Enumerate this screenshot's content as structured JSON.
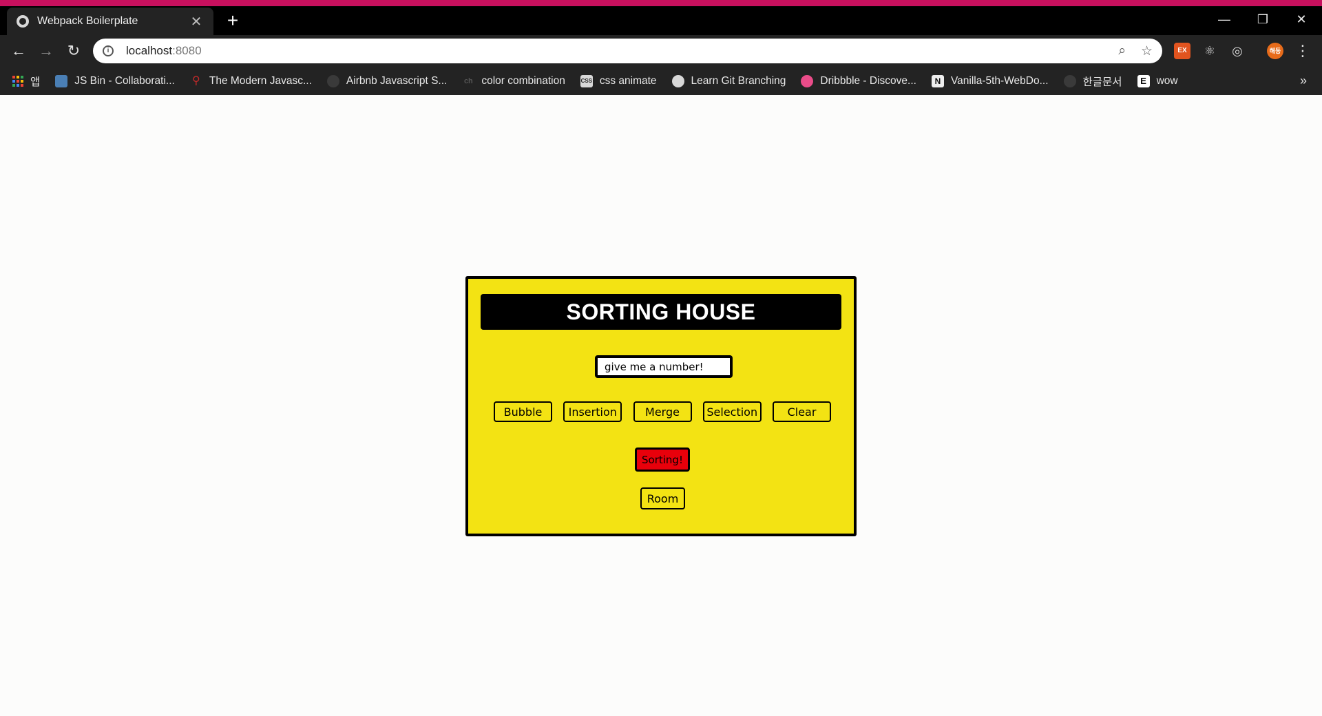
{
  "browser": {
    "tab": {
      "title": "Webpack Boilerplate",
      "close_glyph": "✕",
      "favicon": "globe-icon"
    },
    "new_tab_glyph": "+",
    "window_controls": {
      "minimize": "—",
      "restore": "❐",
      "close": "✕"
    },
    "nav": {
      "back": "←",
      "forward": "→",
      "reload": "↻"
    },
    "address": {
      "host": "localhost",
      "port": ":8080",
      "info_glyph": "i"
    },
    "omnibox_icons": {
      "zoom": "⌕",
      "star": "☆"
    },
    "extensions": [
      {
        "label": "EX",
        "color": "#e2541f"
      },
      {
        "label": "⚛",
        "color": "#232323"
      },
      {
        "label": "◎",
        "color": "#232323"
      }
    ],
    "profile": {
      "label": "해동",
      "color": "#e76b1a"
    },
    "menu_glyph": "⋮",
    "bookmarks": [
      {
        "label": "앱",
        "icon": "apps-grid-icon"
      },
      {
        "label": "JS Bin - Collaborati...",
        "icon": "jsbin-icon",
        "icon_color": "#4a7fb5"
      },
      {
        "label": "The Modern Javasc...",
        "icon": "modern-js-icon",
        "icon_color": "#c42a2a"
      },
      {
        "label": "Airbnb Javascript S...",
        "icon": "github-icon",
        "icon_color": "#444"
      },
      {
        "label": "color combination",
        "icon": "ch-icon",
        "icon_color": "#333"
      },
      {
        "label": "css animate",
        "icon": "css3-icon",
        "icon_color": "#d8d8d8"
      },
      {
        "label": "Learn Git Branching",
        "icon": "globe-icon",
        "icon_color": "#d8d8d8"
      },
      {
        "label": "Dribbble - Discove...",
        "icon": "dribbble-icon",
        "icon_color": "#ea4c89"
      },
      {
        "label": "Vanilla-5th-WebDo...",
        "icon": "notion-icon",
        "icon_color": "#eee"
      },
      {
        "label": "한글문서",
        "icon": "github-icon",
        "icon_color": "#444"
      },
      {
        "label": "wow",
        "icon": "e-icon",
        "icon_color": "#fff"
      }
    ],
    "bookmarks_more": "»"
  },
  "page": {
    "title": "SORTING HOUSE",
    "input_placeholder": "give me a number!",
    "algorithms": [
      "Bubble",
      "Insertion",
      "Merge",
      "Selection",
      "Clear"
    ],
    "sort_button": "Sorting!",
    "room_button": "Room",
    "colors": {
      "panel": "#f3e313",
      "sort_button": "#e8000b",
      "accent_strip": "#c8105e"
    }
  }
}
